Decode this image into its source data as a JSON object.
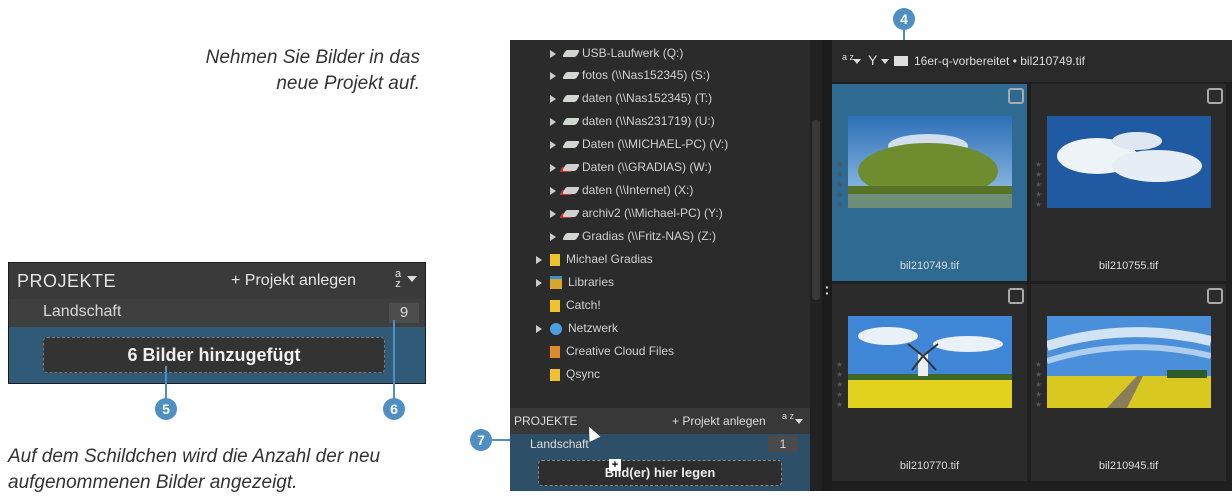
{
  "captions": {
    "top": "Nehmen Sie Bilder in das neue Projekt auf.",
    "bottom": "Auf dem Schildchen wird die Anzahl der neu aufgenommenen Bilder angezeigt."
  },
  "inset": {
    "header_title": "PROJEKTE",
    "new_project": "+ Projekt anlegen",
    "sort_label": "a z",
    "project_name": "Landschaft",
    "project_count": "9",
    "drop_status": "6 Bilder hinzugefügt"
  },
  "markers": {
    "m4": "4",
    "m5": "5",
    "m6": "6",
    "m7": "7"
  },
  "tree": {
    "items": [
      {
        "label": "USB-Laufwerk (Q:)",
        "icon": "drive-icon"
      },
      {
        "label": "fotos (\\\\Nas152345) (S:)",
        "icon": "drive-icon"
      },
      {
        "label": "daten (\\\\Nas152345) (T:)",
        "icon": "drive-icon"
      },
      {
        "label": "daten (\\\\Nas231719) (U:)",
        "icon": "drive-icon"
      },
      {
        "label": "Daten (\\\\MICHAEL-PC) (V:)",
        "icon": "drive-icon"
      },
      {
        "label": "Daten (\\\\GRADIAS) (W:)",
        "icon": "drive-disconnected-icon"
      },
      {
        "label": "daten (\\\\Internet) (X:)",
        "icon": "drive-disconnected-icon"
      },
      {
        "label": "archiv2 (\\\\Michael-PC) (Y:)",
        "icon": "drive-disconnected-icon"
      },
      {
        "label": "Gradias (\\\\Fritz-NAS) (Z:)",
        "icon": "drive-icon"
      },
      {
        "label": "Michael Gradias",
        "icon": "folder-icon"
      },
      {
        "label": "Libraries",
        "icon": "library-icon"
      },
      {
        "label": "Catch!",
        "icon": "folder-icon"
      },
      {
        "label": "Netzwerk",
        "icon": "network-icon"
      },
      {
        "label": "Creative Cloud Files",
        "icon": "creative-cloud-icon"
      },
      {
        "label": "Qsync",
        "icon": "folder-icon"
      }
    ]
  },
  "projects_panel": {
    "title": "PROJEKTE",
    "new_project": "+ Projekt anlegen",
    "sort_label": "a z",
    "project_name": "Landschaft",
    "project_count": "1",
    "drop_label": "Bild(er) hier legen",
    "plus_icon": "+"
  },
  "toolbar": {
    "sort_label": "a z",
    "filter_icon": "Y",
    "path": "16er-q-vorbereitet  •  bil210749.tif"
  },
  "thumbnails": [
    {
      "name": "bil210749.tif",
      "selected": true
    },
    {
      "name": "bil210755.tif",
      "selected": false
    },
    {
      "name": "bil210770.tif",
      "selected": false
    },
    {
      "name": "bil210945.tif",
      "selected": false
    }
  ],
  "colors": {
    "accent": "#4f8fc4",
    "selection": "#2f6a92",
    "panel_dark": "#2b2b2b"
  }
}
